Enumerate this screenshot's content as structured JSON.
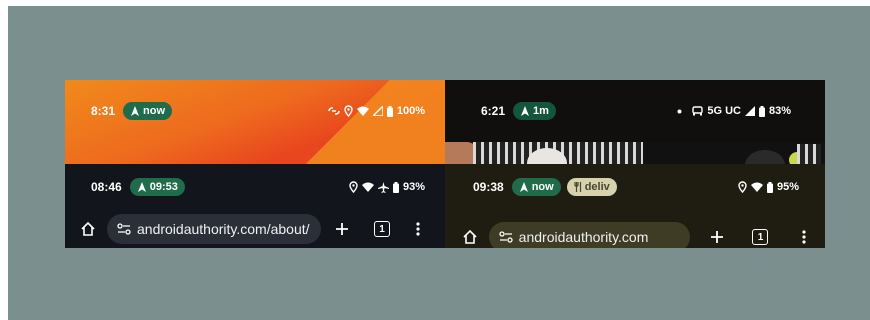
{
  "panels": {
    "top_left": {
      "time": "8:31",
      "chip": "now",
      "battery": "100%"
    },
    "top_right": {
      "time": "6:21",
      "chip": "1m",
      "network": "5G UC",
      "battery": "83%"
    },
    "bottom_left": {
      "time": "08:46",
      "chip": "09:53",
      "battery": "93%",
      "url": "androidauthority.com/about/",
      "tab_count": "1"
    },
    "bottom_right": {
      "time": "09:38",
      "chip": "now",
      "chip2": "deliv",
      "battery": "95%",
      "url": "androidauthority.com",
      "tab_count": "1"
    }
  },
  "colors": {
    "background": "#7a8f8e",
    "chip_green": "#1f6b4a",
    "chip_tan": "#d6d2ae"
  }
}
